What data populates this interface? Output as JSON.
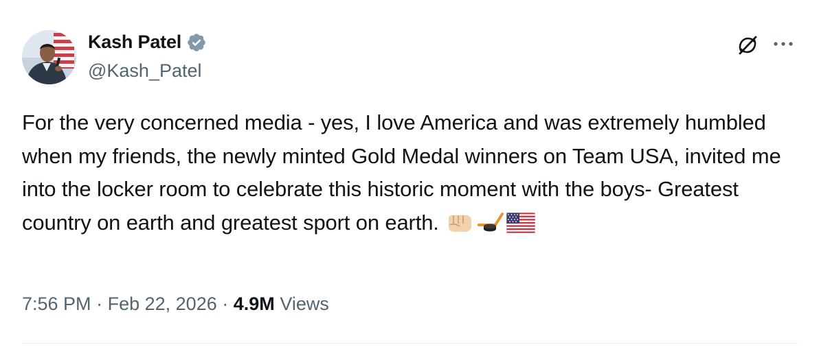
{
  "author": {
    "display_name": "Kash Patel",
    "handle": "@Kash_Patel",
    "verified": true,
    "avatar_icon": "avatar-photo"
  },
  "tweet": {
    "text": "For the very concerned media - yes, I love America and was extremely humbled when my friends, the newly minted Gold Medal winners on Team USA, invited me into the locker room to celebrate this historic moment with the boys- Greatest country on earth and greatest sport on earth.",
    "emojis": [
      "fist-emoji",
      "hockey-emoji",
      "us-flag-emoji"
    ]
  },
  "meta": {
    "time": "7:56 PM",
    "separator": "·",
    "date": "Feb 22, 2026",
    "views_count": "4.9M",
    "views_label": "Views"
  },
  "actions": {
    "grok_icon": "grok-icon",
    "more_icon": "more-icon"
  },
  "colors": {
    "primary_text": "#0f1419",
    "secondary_text": "#536471",
    "verified_badge": "#829aab",
    "divider": "#eff3f4"
  }
}
